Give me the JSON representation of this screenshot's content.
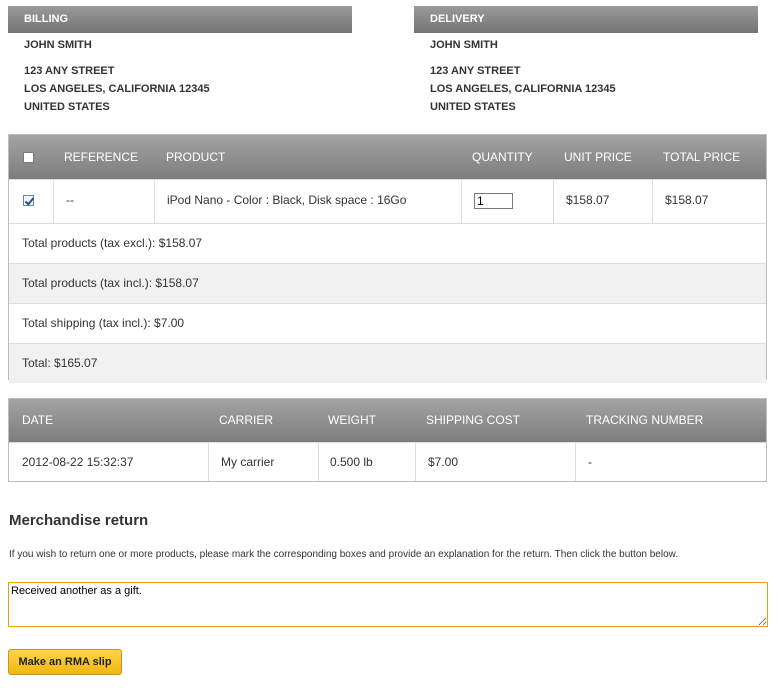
{
  "billing": {
    "heading": "BILLING",
    "name": "JOHN SMITH",
    "street": "123 ANY STREET",
    "city": "LOS ANGELES, CALIFORNIA 12345",
    "country": "UNITED STATES"
  },
  "delivery": {
    "heading": "DELIVERY",
    "name": "JOHN SMITH",
    "street": "123 ANY STREET",
    "city": "LOS ANGELES, CALIFORNIA 12345",
    "country": "UNITED STATES"
  },
  "products": {
    "headers": [
      "REFERENCE",
      "PRODUCT",
      "QUANTITY",
      "UNIT PRICE",
      "TOTAL PRICE"
    ],
    "select_all_checked": false,
    "rows": [
      {
        "checked": true,
        "reference": "--",
        "product": "iPod Nano - Color : Black, Disk space : 16Go",
        "quantity": "1",
        "unit_price": "$158.07",
        "total_price": "$158.07"
      }
    ],
    "totals": [
      "Total products (tax excl.): $158.07",
      "Total products (tax incl.): $158.07",
      "Total shipping (tax incl.): $7.00",
      "Total: $165.07"
    ]
  },
  "shipping": {
    "headers": [
      "DATE",
      "CARRIER",
      "WEIGHT",
      "SHIPPING COST",
      "TRACKING NUMBER"
    ],
    "rows": [
      {
        "date": "2012-08-22 15:32:37",
        "carrier": "My carrier",
        "weight": "0.500 lb",
        "cost": "$7.00",
        "tracking": "-"
      }
    ]
  },
  "rma": {
    "title": "Merchandise return",
    "description": "If you wish to return one or more products, please mark the corresponding boxes and provide an explanation for the return. Then click the button below.",
    "explanation_value": "Received another as a gift.",
    "button_label": "Make an RMA slip"
  },
  "colors": {
    "header_gradient_top": "#a3a3a3",
    "header_gradient_bottom": "#7d7d7d",
    "button_yellow": "#f2b70d",
    "textarea_border": "#e3a21a",
    "alt_row": "#f1f1f1"
  }
}
